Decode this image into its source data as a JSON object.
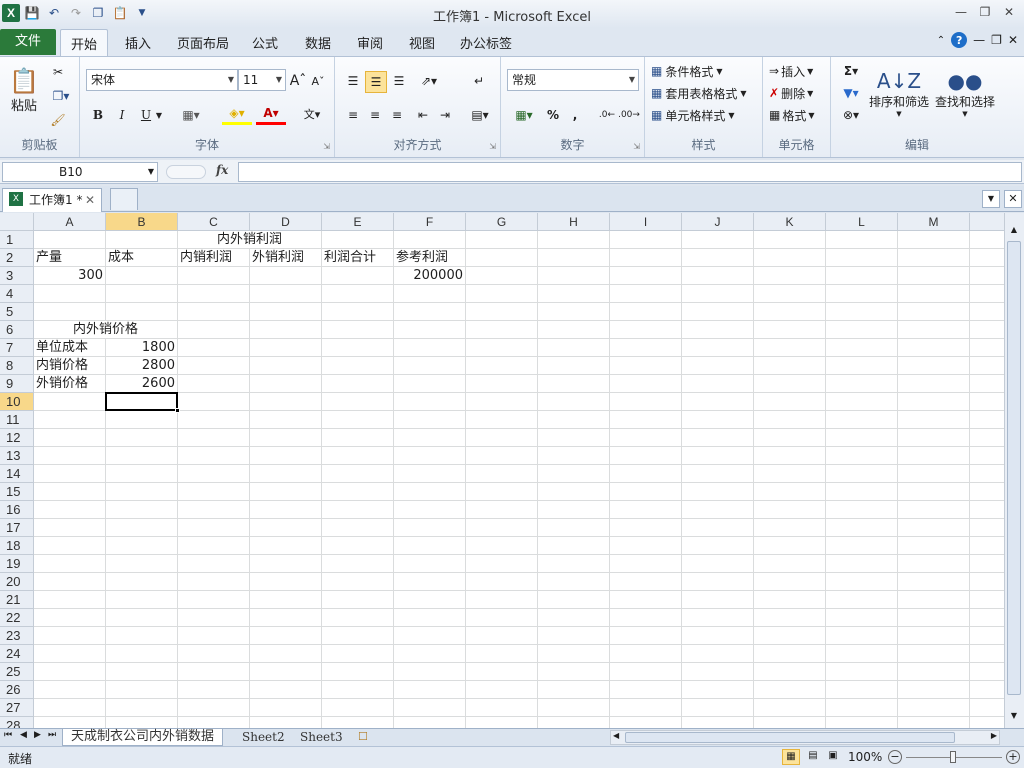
{
  "window": {
    "title": "工作簿1 - Microsoft Excel"
  },
  "ribbon_tabs": [
    "文件",
    "开始",
    "插入",
    "页面布局",
    "公式",
    "数据",
    "审阅",
    "视图",
    "办公标签"
  ],
  "clipboard": {
    "paste": "粘贴",
    "label": "剪贴板"
  },
  "font": {
    "name": "宋体",
    "size": "11",
    "label": "字体",
    "bold": "B",
    "italic": "I",
    "underline": "U"
  },
  "alignment": {
    "label": "对齐方式"
  },
  "number": {
    "format": "常规",
    "label": "数字",
    "percent": "%",
    "comma": ","
  },
  "styles": {
    "conditional": "条件格式",
    "table": "套用表格格式",
    "cell": "单元格样式",
    "label": "样式"
  },
  "cells_group": {
    "insert": "插入",
    "delete": "删除",
    "format": "格式",
    "label": "单元格"
  },
  "editing": {
    "sort": "排序和筛选",
    "find": "查找和选择",
    "label": "编辑"
  },
  "formula_bar": {
    "name_box": "B10",
    "fx": "fx",
    "content": ""
  },
  "workbook_tab": "工作簿1 *",
  "columns": [
    "A",
    "B",
    "C",
    "D",
    "E",
    "F",
    "G",
    "H",
    "I",
    "J",
    "K",
    "L",
    "M"
  ],
  "selected_col": "B",
  "selected_row": 10,
  "rows": 28,
  "cells": [
    {
      "ref": "C1",
      "text": "内外销利润",
      "align": "center",
      "span": 2
    },
    {
      "ref": "A2",
      "text": "产量",
      "align": "left"
    },
    {
      "ref": "B2",
      "text": "成本",
      "align": "left"
    },
    {
      "ref": "C2",
      "text": "内销利润",
      "align": "left"
    },
    {
      "ref": "D2",
      "text": "外销利润",
      "align": "left"
    },
    {
      "ref": "E2",
      "text": "利润合计",
      "align": "left"
    },
    {
      "ref": "F2",
      "text": "参考利润",
      "align": "left"
    },
    {
      "ref": "A3",
      "text": "300",
      "align": "right"
    },
    {
      "ref": "F3",
      "text": "200000",
      "align": "right"
    },
    {
      "ref": "A6",
      "text": "内外销价格",
      "align": "center",
      "span": 2
    },
    {
      "ref": "A7",
      "text": "单位成本",
      "align": "left"
    },
    {
      "ref": "B7",
      "text": "1800",
      "align": "right"
    },
    {
      "ref": "A8",
      "text": "内销价格",
      "align": "left"
    },
    {
      "ref": "B8",
      "text": "2800",
      "align": "right"
    },
    {
      "ref": "A9",
      "text": "外销价格",
      "align": "left"
    },
    {
      "ref": "B9",
      "text": "2600",
      "align": "right"
    }
  ],
  "sheet_tabs": [
    "天成制衣公司内外销数据",
    "Sheet2",
    "Sheet3"
  ],
  "status": {
    "ready": "就绪",
    "zoom": "100%"
  }
}
